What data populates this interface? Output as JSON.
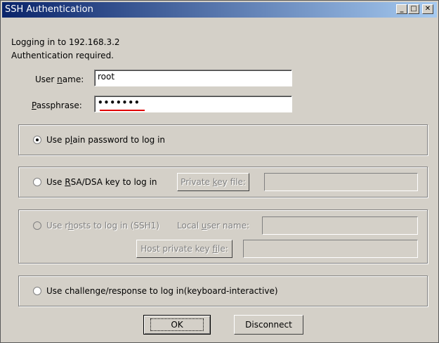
{
  "window": {
    "title": "SSH Authentication",
    "minimize_glyph": "_",
    "maximize_glyph": "□",
    "close_glyph": "✕"
  },
  "header": {
    "line1": "Logging in to 192.168.3.2",
    "line2": "Authentication required."
  },
  "form": {
    "username_label_pre": "User ",
    "username_label_accel": "n",
    "username_label_post": "ame:",
    "username_value": "root",
    "passphrase_label_accel": "P",
    "passphrase_label_post": "assphrase:",
    "passphrase_value": "•••••••"
  },
  "options": {
    "plain": {
      "pre": "Use p",
      "accel": "l",
      "post": "ain password to log in",
      "selected": true
    },
    "rsa": {
      "pre": "Use ",
      "accel": "R",
      "post": "SA/DSA key to log in",
      "key_button_pre": "Private ",
      "key_button_accel": "k",
      "key_button_post": "ey file:"
    },
    "rhosts": {
      "pre": "Use r",
      "accel": "h",
      "post": "osts to log in (SSH1)",
      "local_user_pre": "Local ",
      "local_user_accel": "u",
      "local_user_post": "ser name:",
      "host_key_pre": "Host private key ",
      "host_key_accel": "f",
      "host_key_post": "ile:"
    },
    "challenge": {
      "label": "Use challenge/response to log in(keyboard-interactive)"
    }
  },
  "buttons": {
    "ok": "OK",
    "disconnect": "Disconnect"
  }
}
